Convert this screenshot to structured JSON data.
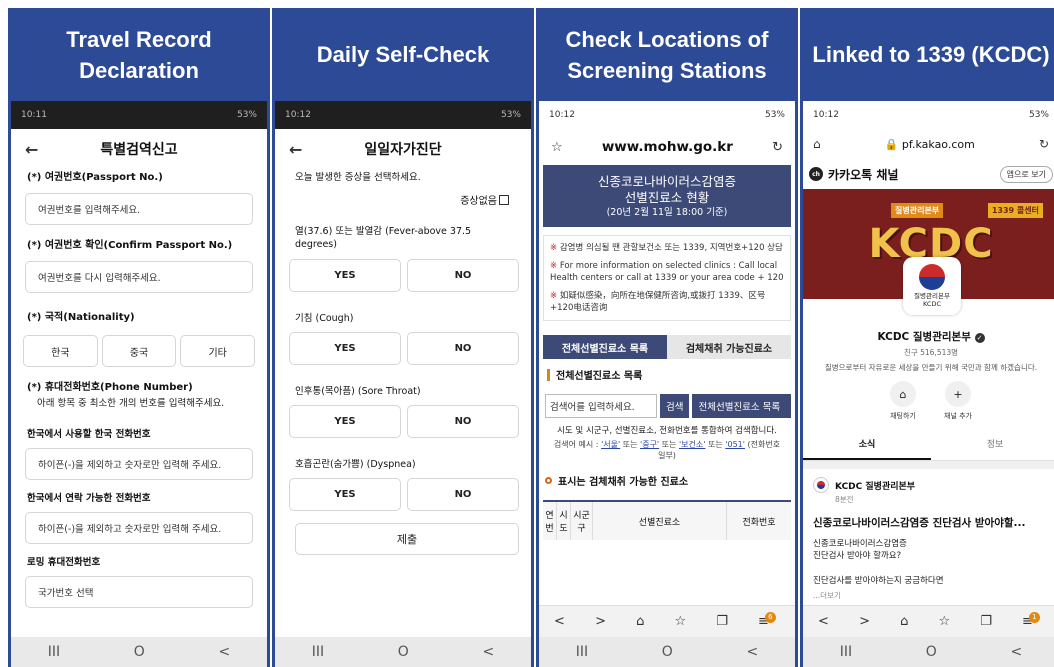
{
  "panels": {
    "p1": {
      "title": "Travel Record Declaration"
    },
    "p2": {
      "title": "Daily Self-Check"
    },
    "p3": {
      "title": "Check Locations of Screening Stations"
    },
    "p4": {
      "title": "Linked to 1339 (KCDC)"
    }
  },
  "nav": {
    "recent": "III",
    "home": "O",
    "back": "<"
  },
  "travel": {
    "status_time": "10:11",
    "status_right": "53%",
    "back": "←",
    "header": "특별검역신고",
    "passport_label": "(*) 여권번호(Passport No.)",
    "passport_placeholder": "여권번호를 입력해주세요.",
    "passport_confirm_label": "(*) 여권번호 확인(Confirm Passport No.)",
    "passport_confirm_placeholder": "여권번호를 다시 입력해주세요.",
    "nationality_label": "(*) 국적(Nationality)",
    "nationality_options": [
      "한국",
      "중국",
      "기타"
    ],
    "phone_label": "(*) 휴대전화번호(Phone Number)",
    "phone_sub": "아래 항목 중 최소한 개의 번호를 입력해주세요.",
    "korea_phone_label": "한국에서 사용할 한국 전화번호",
    "korea_phone_placeholder": "하이픈(-)을 제외하고 숫자로만 입력해 주세요.",
    "contact_phone_label": "한국에서 연락 가능한 전화번호",
    "contact_phone_placeholder": "하이픈(-)을 제외하고 숫자로만 입력해 주세요.",
    "roaming_label": "로밍 휴대전화번호",
    "roaming_placeholder": "국가번호 선택"
  },
  "selfcheck": {
    "status_time": "10:12",
    "status_right": "53%",
    "back": "←",
    "header": "일일자가진단",
    "instruction": "오늘 발생한 증상을 선택하세요.",
    "no_symptom": "증상없음",
    "symptoms": [
      {
        "label": "열(37.6) 또는 발열감 (Fever-above 37.5 degrees)"
      },
      {
        "label": "기침 (Cough)"
      },
      {
        "label": "인후통(목아픔) (Sore Throat)"
      },
      {
        "label": "호흡곤란(숨가쁨) (Dyspnea)"
      }
    ],
    "yes": "YES",
    "no": "NO",
    "submit": "제출"
  },
  "mohw": {
    "status_time": "10:12",
    "status_right": "53%",
    "url": "www.mohw.go.kr",
    "banner_title_1": "신종코로나바이러스감염증",
    "banner_title_2": "선별진료소 현황",
    "banner_date": "(20년 2월 11일 18:00 기준)",
    "notice_mark": "※",
    "notice_ko": "감염병 의심될 땐 관할보건소 또는 1339, 지역번호+120 상담",
    "notice_en": "For more information on selected clinics : Call local Health centers or call at 1339 or your area code + 120",
    "notice_zh": "如疑似感染，向所在地保健所咨询,或拨打 1339、区号+120电话咨询",
    "tab_all": "전체선별진료소 목록",
    "tab_sample": "검체채취 가능진료소",
    "section_title": "전체선별진료소 목록",
    "search_placeholder": "검색어를 입력하세요.",
    "search_button": "검색",
    "all_button": "전체선별진료소 목록",
    "help_text": "시도 및 시군구, 선별진료소, 전화번호를 통합하여 검색합니다.",
    "help_example_prefix": "검색어 예시 :",
    "help_ex1": "'서울'",
    "help_ex2": "'중구'",
    "help_ex3": "'보건소'",
    "help_ex4": "'051'",
    "help_or": "또는",
    "help_suffix": "(전화번호 일부)",
    "section2_title": "표시는 검체채취 가능한 진료소",
    "col_no": "연번",
    "col_sido": "시도",
    "col_sigungu": "시군구",
    "col_clinic": "선별진료소",
    "col_phone": "전화번호",
    "tool_back": "<",
    "tool_fwd": ">",
    "tool_home": "⌂",
    "tool_star": "☆",
    "tool_tabs": "❐",
    "tool_menu": "≡",
    "badge": "6"
  },
  "kakao": {
    "status_time": "10:12",
    "status_right": "53%",
    "url": "pf.kakao.com",
    "channel_title": "카카오톡 채널",
    "channel_logo": "ch",
    "open_app": "앱으로 보기",
    "hero_text": "KCDC",
    "hero_tag": "질병관리본부",
    "hero_tag2": "1339 콜센터",
    "profile_name_1": "질병관리본부",
    "profile_name_2": "KCDC",
    "name": "KCDC 질병관리본부",
    "friends": "친구 516,513명",
    "desc": "질병으로부터 자유로운 세상을 만들기 위해 국민과 함께 하겠습니다.",
    "btn_chat": "채팅하기",
    "btn_add": "채널 추가",
    "tab_news": "소식",
    "tab_info": "정보",
    "post_author": "KCDC 질병관리본부",
    "post_ago": "8분전",
    "post_head": "신종코로나바이러스감염증 진단검사 받아야할...",
    "post_body_1": "신종코로나바이러스감염증",
    "post_body_2": "진단검사 받아야 할까요?",
    "post_body_3": "진단검사를 받아야하는지 궁금하다면",
    "post_more": "...더보기",
    "badge": "1"
  }
}
